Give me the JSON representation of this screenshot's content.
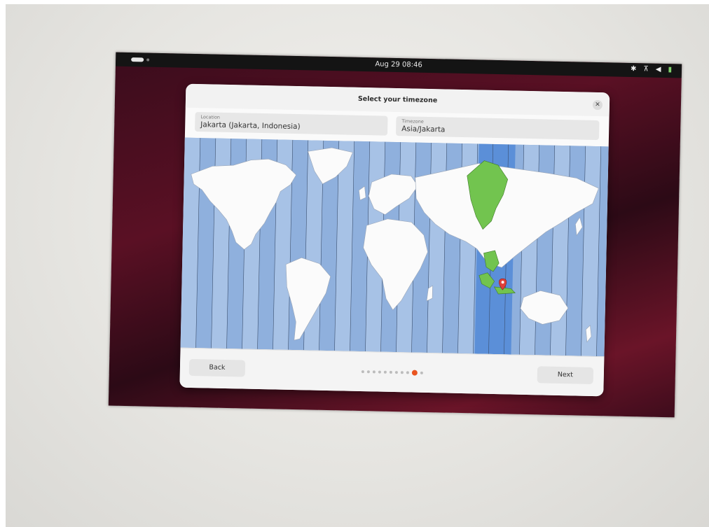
{
  "topbar": {
    "clock": "Aug 29  08:46",
    "icons": [
      "accessibility-icon",
      "network-icon",
      "volume-icon",
      "battery-icon"
    ]
  },
  "dialog": {
    "title": "Select your timezone",
    "close_icon": "close-icon",
    "location": {
      "label": "Location",
      "value": "Jakarta (Jakarta, Indonesia)"
    },
    "timezone": {
      "label": "Timezone",
      "value": "Asia/Jakarta"
    },
    "map": {
      "selected_zone": "Asia/Jakarta",
      "highlight_color": "#72c44f",
      "zone_band_color": "#5b8fd8"
    },
    "back_label": "Back",
    "next_label": "Next",
    "progress": {
      "total_steps": 11,
      "current_step": 10
    }
  },
  "colors": {
    "accent": "#e95420",
    "ocean": "#8fb0dd",
    "land": "#fbfbfb"
  }
}
